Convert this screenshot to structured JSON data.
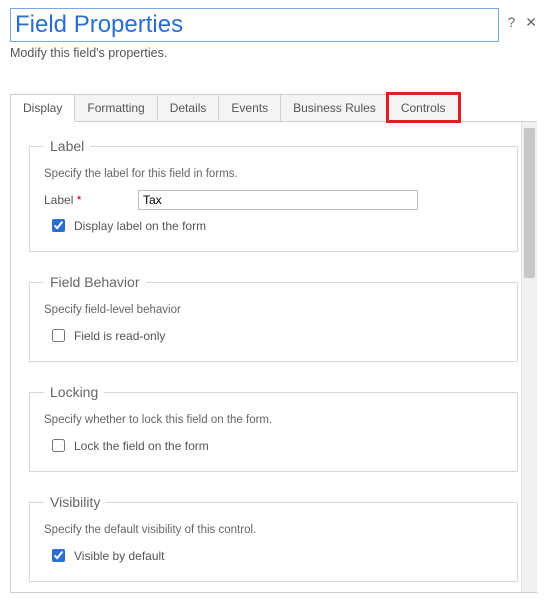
{
  "header": {
    "title": "Field Properties",
    "subtitle": "Modify this field's properties.",
    "help_icon": "?",
    "close_icon": "✕"
  },
  "tabs": {
    "display": "Display",
    "formatting": "Formatting",
    "details": "Details",
    "events": "Events",
    "business_rules": "Business Rules",
    "controls": "Controls"
  },
  "sections": {
    "label": {
      "legend": "Label",
      "desc": "Specify the label for this field in forms.",
      "field_label": "Label",
      "required_mark": "*",
      "value": "Tax",
      "display_label_text": "Display label on the form",
      "display_label_checked": true
    },
    "behavior": {
      "legend": "Field Behavior",
      "desc": "Specify field-level behavior",
      "readonly_text": "Field is read-only",
      "readonly_checked": false
    },
    "locking": {
      "legend": "Locking",
      "desc": "Specify whether to lock this field on the form.",
      "lock_text": "Lock the field on the form",
      "lock_checked": false
    },
    "visibility": {
      "legend": "Visibility",
      "desc": "Specify the default visibility of this control.",
      "visible_text": "Visible by default",
      "visible_checked": true
    }
  }
}
